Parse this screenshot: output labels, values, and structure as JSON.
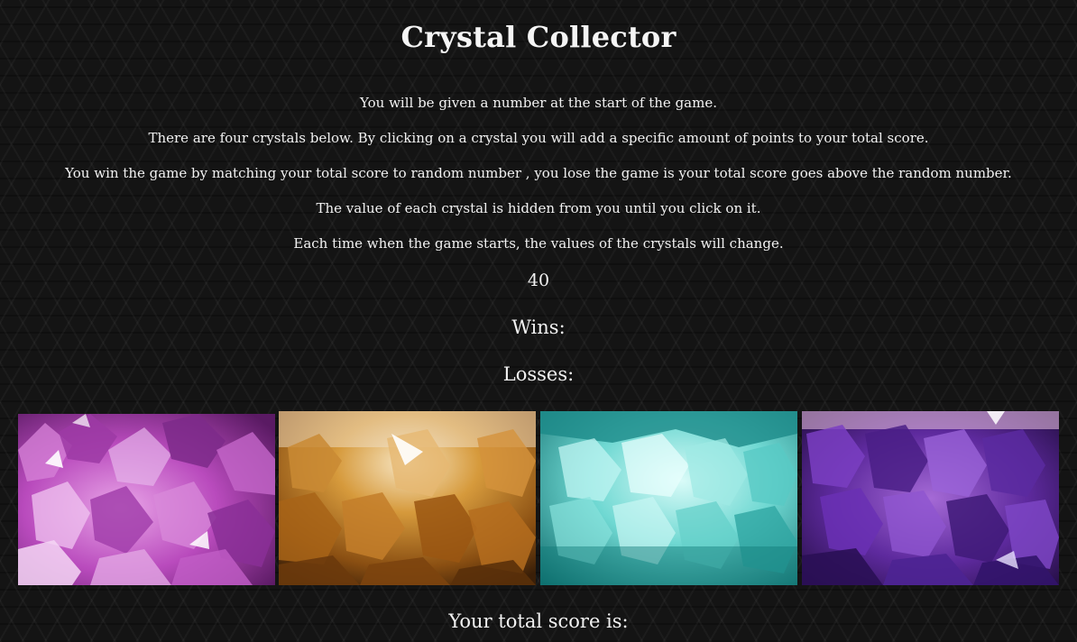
{
  "game": {
    "title": "Crystal Collector",
    "instructions": [
      "You will be given a number at the start of the game.",
      "There are four crystals below. By clicking on a crystal you will add a specific amount of points to your total score.",
      "You win the game by matching your total score to random number , you lose the game is your total score goes above the random number.",
      "The value of each crystal is hidden from you until you click on it.",
      "Each time when the game starts, the values of the crystals will change."
    ],
    "random_number": "40",
    "wins_label": "Wins:",
    "losses_label": "Losses:",
    "score_label": "Your total score is:"
  },
  "crystals": [
    {
      "name": "pink amethyst crystal",
      "color": "#c24fc4"
    },
    {
      "name": "citrine crystal",
      "color": "#b8781f"
    },
    {
      "name": "aqua crystal",
      "color": "#3fc4c0"
    },
    {
      "name": "purple amethyst crystal",
      "color": "#6a2fa8"
    }
  ],
  "colors": {
    "background": "#141414",
    "text": "#f2f2f2"
  }
}
